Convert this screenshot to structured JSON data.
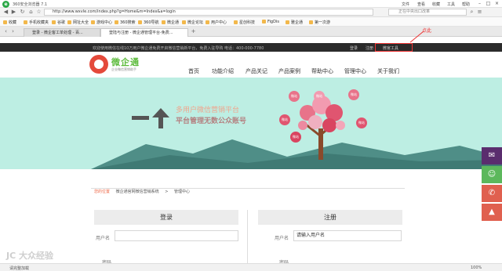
{
  "browser": {
    "title": "360安全浏览器 7.1",
    "menu": [
      "文件",
      "查看",
      "收藏",
      "工具",
      "帮助"
    ],
    "url": "http://www.wxvle.com/index.php?g=Home&m=Index&a=login",
    "search_placeholder": "正在中央出口改革",
    "bookmarks": [
      "收藏",
      "手机收藏夹",
      "谷歌",
      "网址大全",
      "游戏中心",
      "360搜索",
      "360导航",
      "微企通",
      "微企论坛",
      "用户中心",
      "星创科技",
      "FigDis",
      "雅企通",
      "第一次游"
    ],
    "tabs": [
      "登录 - 微企客工单处理 - 百...",
      "登陆与注册 - 微企通管理平台-免费..."
    ],
    "status_text": "请完整加载",
    "zoom": "100%"
  },
  "site": {
    "info_text": "欢迎使用微信在线10万用户微企通免费开启微信营销新平台，免费入驻导购 电话：400-000-7780",
    "top_links": {
      "login": "登录",
      "register": "注册",
      "tool": "微官工具"
    },
    "annotation": "点此",
    "logo_name": "微企通",
    "logo_sub": "企业微信营销助手",
    "nav": [
      "首页",
      "功能介绍",
      "产品关记",
      "产品案例",
      "帮助中心",
      "管理中心",
      "关于我们"
    ],
    "banner_title": "多用户微信营销平台",
    "banner_sub": "平台管理无数公众账号",
    "banner_bubbles": [
      "微站",
      "微站",
      "微站",
      "微站",
      "微站",
      "微站"
    ],
    "breadcrumb": {
      "label": "您的位置",
      "site": "微企通官网微信营销系统",
      "sep": ">",
      "page": "管理中心"
    },
    "login_panel": {
      "title": "登录",
      "username_label": "用户名",
      "password_label": "密码"
    },
    "register_panel": {
      "title": "注册",
      "username_label": "用户名",
      "username_placeholder": "请输入用户名",
      "password_label": "密码"
    },
    "watermark": "JC 大众经验"
  }
}
